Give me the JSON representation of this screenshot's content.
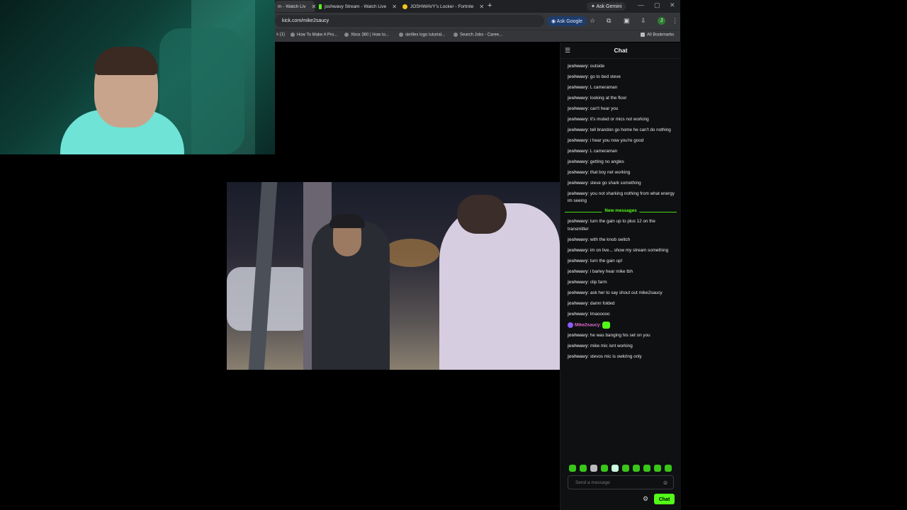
{
  "browser": {
    "tabs": [
      {
        "label": "m - Watch Liv",
        "active": true
      },
      {
        "label": "joshwavy Stream - Watch Live",
        "active": false
      },
      {
        "label": "JOSHWAVY's Locker - Fortnite",
        "active": false
      }
    ],
    "new_tab": "+",
    "ask_gemini": "Ask Gemini",
    "url": "kick.com/mike2saucy",
    "ask_google": "Ask Google",
    "profile_initial": "J",
    "bookmarks": [
      "s (1)",
      "How To Make A Pro...",
      "Xbox 360 | How to...",
      "skrillex logo tutorial...",
      "Search Jobs - Caree..."
    ],
    "all_bookmarks": "All Bookmarks"
  },
  "chat": {
    "title": "Chat",
    "messages_before": [
      {
        "user": "joshwavy",
        "text": "outside"
      },
      {
        "user": "joshwavy",
        "text": "go to bed steve"
      },
      {
        "user": "joshwavy",
        "text": "L cameraman"
      },
      {
        "user": "joshwavy",
        "text": "looking at the floor"
      },
      {
        "user": "joshwavy",
        "text": "can't hear you"
      },
      {
        "user": "joshwavy",
        "text": "it's muted or mics not working"
      },
      {
        "user": "joshwavy",
        "text": "tell brandon go home he can't do nothing"
      },
      {
        "user": "joshwavy",
        "text": "i hear you now you're good"
      },
      {
        "user": "joshwavy",
        "text": "L cameraman"
      },
      {
        "user": "joshwavy",
        "text": "getting no angles"
      },
      {
        "user": "joshwavy",
        "text": "that boy net working"
      },
      {
        "user": "joshwavy",
        "text": "steve go shark something"
      },
      {
        "user": "joshwavy",
        "text": "you not sharking nothing from what energy im seeing"
      }
    ],
    "new_messages_label": "New messages",
    "messages_after": [
      {
        "user": "joshwavy",
        "text": "turn the gain up to plus 12 on the transmitter"
      },
      {
        "user": "joshwavy",
        "text": "with the knob switch"
      },
      {
        "user": "joshwavy",
        "text": "im on live... show my stream something"
      },
      {
        "user": "joshwavy",
        "text": "turn the gain up!"
      },
      {
        "user": "joshwavy",
        "text": "i barley hear mike tbh"
      },
      {
        "user": "joshwavy",
        "text": "clip farm"
      },
      {
        "user": "joshwavy",
        "text": "ask her to say shout out mike2saucy"
      },
      {
        "user": "joshwavy",
        "text": "damn folded"
      },
      {
        "user": "joshwavy",
        "text": "lmaooooo"
      },
      {
        "user": "Mike2saucy",
        "text": "",
        "emote": true
      },
      {
        "user": "joshwavy",
        "text": "he was banging his set on you"
      },
      {
        "user": "joshwavy",
        "text": "mike mic isnt working"
      },
      {
        "user": "joshwavy",
        "text": "stevos mic is owkring only"
      }
    ],
    "input_placeholder": "Send a message",
    "send_label": "Chat",
    "accent": "#53fc18"
  }
}
